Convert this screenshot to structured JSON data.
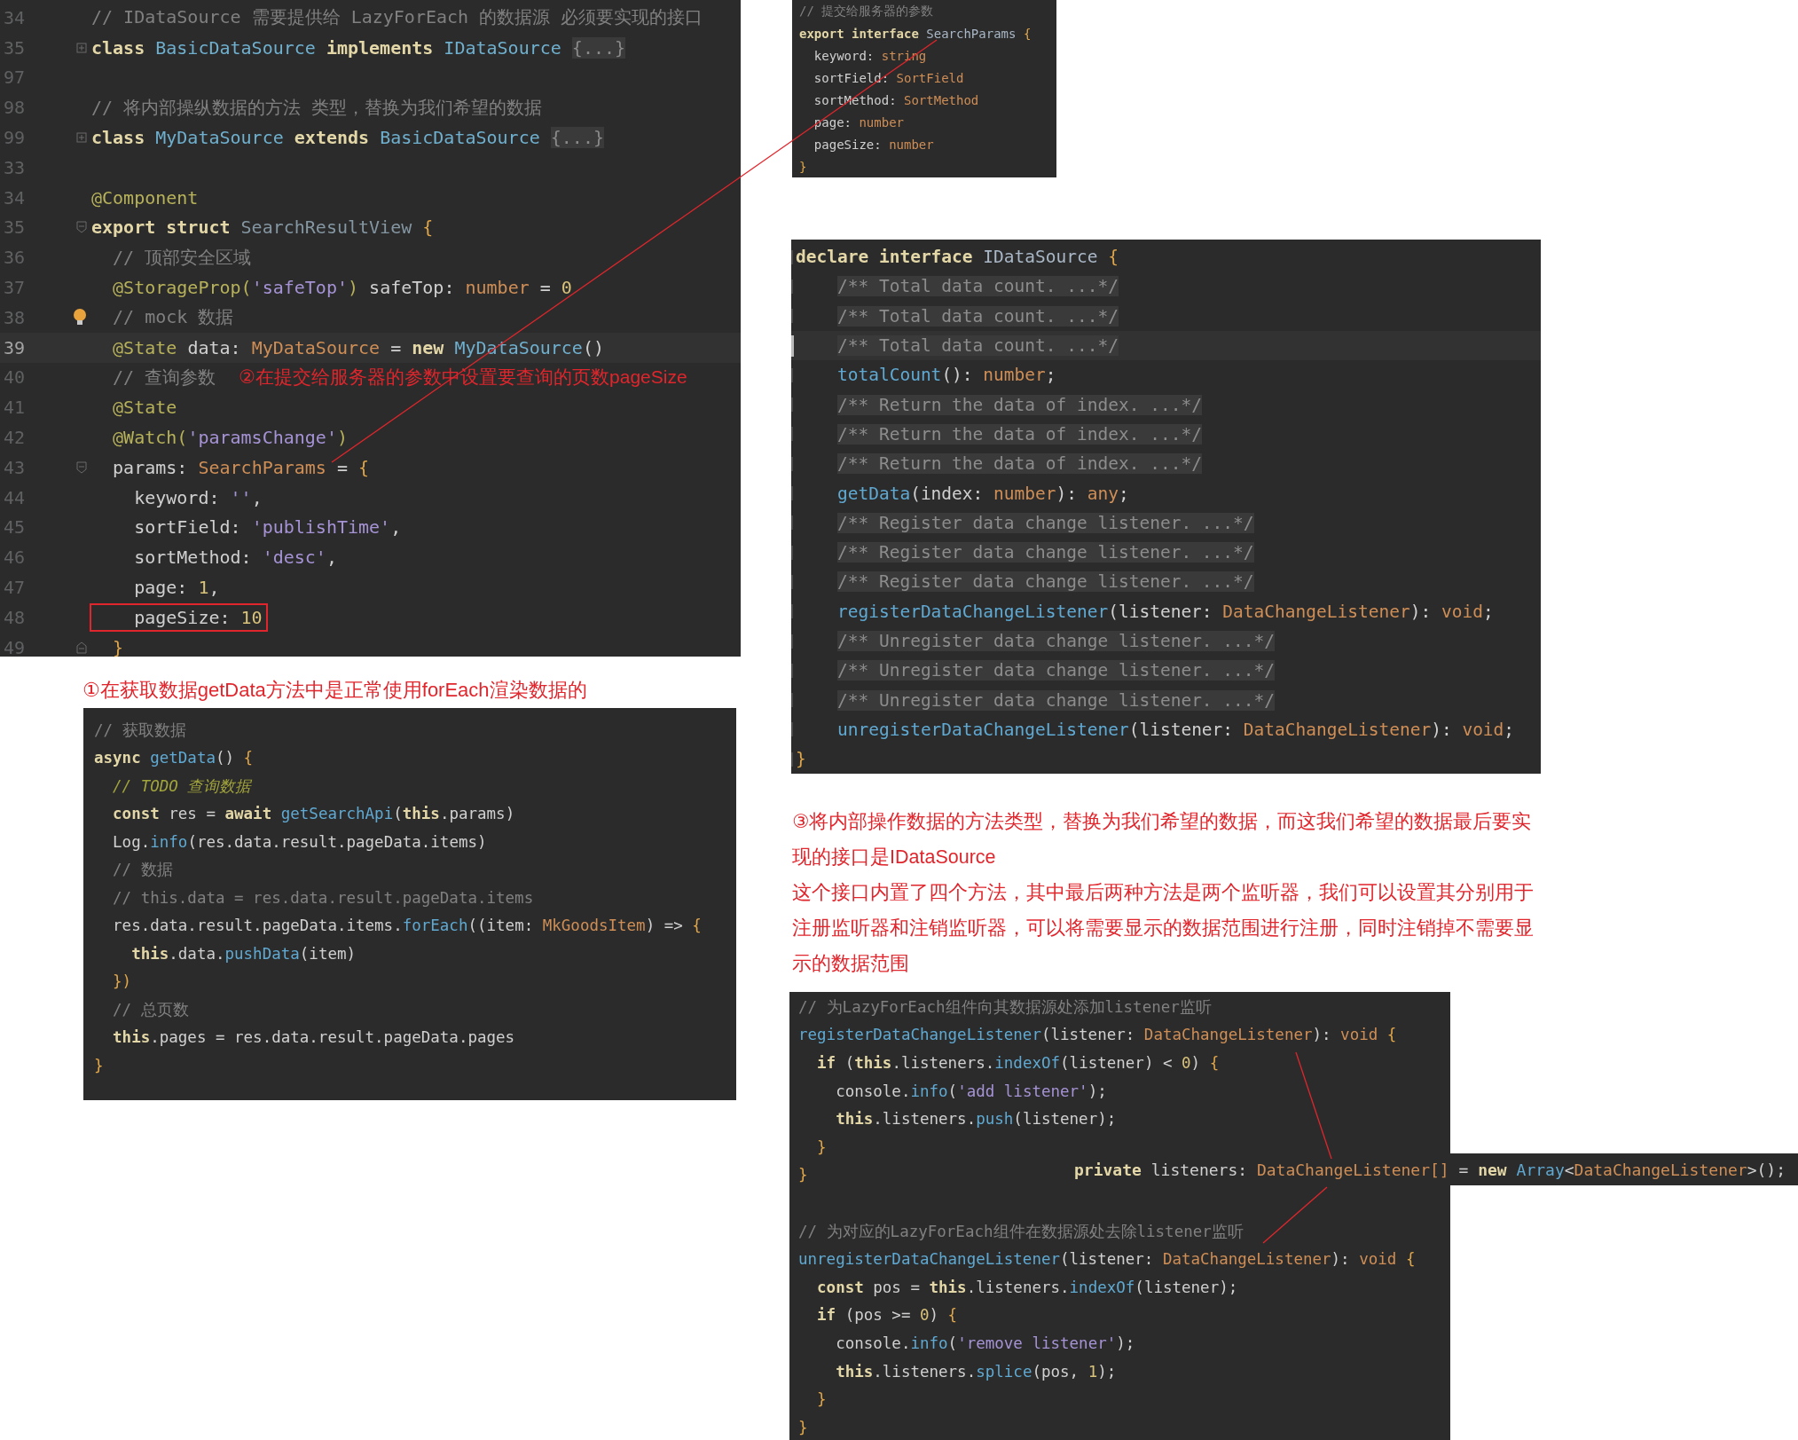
{
  "panels": [
    {
      "kind": "editor",
      "lines": [
        {
          "number": "34",
          "kind": "plain",
          "current": false,
          "boxed": false,
          "tokens": [
            {
              "kind": "cm",
              "text": "// IDataSource 需要提供给 LazyForEach 的数据源 必须要实现的接口"
            }
          ]
        },
        {
          "number": "35",
          "kind": "fold-collapsed",
          "current": false,
          "boxed": false,
          "tokens": [
            {
              "kind": "kw",
              "text": "class "
            },
            {
              "kind": "cls",
              "text": "BasicDataSource "
            },
            {
              "kind": "kw",
              "text": "implements "
            },
            {
              "kind": "cls",
              "text": "IDataSource "
            },
            {
              "kind": "fold",
              "text": "{...}"
            }
          ]
        },
        {
          "number": "97",
          "kind": "plain",
          "current": false
        },
        {
          "number": "98",
          "kind": "plain",
          "current": false,
          "boxed": false,
          "tokens": [
            {
              "kind": "cm",
              "text": "// 将内部操纵数据的方法 类型，替换为我们希望的数据"
            }
          ]
        },
        {
          "number": "99",
          "kind": "fold-collapsed",
          "current": false,
          "boxed": false,
          "tokens": [
            {
              "kind": "kw",
              "text": "class "
            },
            {
              "kind": "cls",
              "text": "MyDataSource "
            },
            {
              "kind": "kw",
              "text": "extends "
            },
            {
              "kind": "cls",
              "text": "BasicDataSource "
            },
            {
              "kind": "fold",
              "text": "{...}"
            }
          ]
        },
        {
          "number": "33",
          "kind": "plain",
          "current": false
        },
        {
          "number": "34",
          "kind": "plain",
          "current": false,
          "boxed": false,
          "tokens": [
            {
              "kind": "deco",
              "text": "@Component"
            }
          ]
        },
        {
          "number": "35",
          "kind": "fold-open",
          "current": false,
          "boxed": false,
          "tokens": [
            {
              "kind": "kw",
              "text": "export struct "
            },
            {
              "kind": "dim",
              "text": "SearchResultView "
            },
            {
              "kind": "punc",
              "text": "{"
            }
          ]
        },
        {
          "number": "36",
          "kind": "plain",
          "current": false,
          "boxed": false,
          "tokens": [
            {
              "kind": "cm",
              "text": "  // 顶部安全区域"
            }
          ]
        },
        {
          "number": "37",
          "kind": "plain",
          "current": false,
          "boxed": false,
          "tokens": [
            {
              "kind": "deco",
              "text": "  @StorageProp("
            },
            {
              "kind": "str",
              "text": "'safeTop'"
            },
            {
              "kind": "deco",
              "text": ") "
            },
            {
              "kind": "plain",
              "text": "safeTop: "
            },
            {
              "kind": "type",
              "text": "number"
            },
            {
              "kind": "plain",
              "text": " = "
            },
            {
              "kind": "num",
              "text": "0"
            }
          ]
        },
        {
          "number": "38",
          "kind": "bulb",
          "current": false,
          "boxed": false,
          "tokens": [
            {
              "kind": "cm",
              "text": "  // mock 数据"
            }
          ]
        },
        {
          "number": "39",
          "kind": "plain",
          "current": true,
          "boxed": false,
          "tokens": [
            {
              "kind": "deco",
              "text": "  @State "
            },
            {
              "kind": "plain",
              "text": "data: "
            },
            {
              "kind": "type",
              "text": "MyDataSource"
            },
            {
              "kind": "plain",
              "text": " = "
            },
            {
              "kind": "kw",
              "text": "new "
            },
            {
              "kind": "cls",
              "text": "MyDataSource"
            },
            {
              "kind": "plain",
              "text": "()"
            }
          ]
        },
        {
          "number": "40",
          "kind": "plain",
          "current": false,
          "boxed": false,
          "annotation": "②在提交给服务器的参数中设置要查询的页数pageSize",
          "tokens": [
            {
              "kind": "cm",
              "text": "  // 查询参数"
            }
          ]
        },
        {
          "number": "41",
          "kind": "plain",
          "current": false,
          "boxed": false,
          "tokens": [
            {
              "kind": "deco",
              "text": "  @State"
            }
          ]
        },
        {
          "number": "42",
          "kind": "plain",
          "current": false,
          "boxed": false,
          "tokens": [
            {
              "kind": "deco",
              "text": "  @Watch("
            },
            {
              "kind": "str",
              "text": "'paramsChange'"
            },
            {
              "kind": "deco",
              "text": ")"
            }
          ]
        },
        {
          "number": "43",
          "kind": "fold-open",
          "current": false,
          "boxed": false,
          "tokens": [
            {
              "kind": "plain",
              "text": "  params: "
            },
            {
              "kind": "type",
              "text": "SearchParams"
            },
            {
              "kind": "plain",
              "text": " = "
            },
            {
              "kind": "punc",
              "text": "{"
            }
          ]
        },
        {
          "number": "44",
          "kind": "plain",
          "current": false,
          "boxed": false,
          "tokens": [
            {
              "kind": "plain",
              "text": "    keyword: "
            },
            {
              "kind": "str",
              "text": "''"
            },
            {
              "kind": "plain",
              "text": ","
            }
          ]
        },
        {
          "number": "45",
          "kind": "plain",
          "current": false,
          "boxed": false,
          "tokens": [
            {
              "kind": "plain",
              "text": "    sortField: "
            },
            {
              "kind": "str",
              "text": "'publishTime'"
            },
            {
              "kind": "plain",
              "text": ","
            }
          ]
        },
        {
          "number": "46",
          "kind": "plain",
          "current": false,
          "boxed": false,
          "tokens": [
            {
              "kind": "plain",
              "text": "    sortMethod: "
            },
            {
              "kind": "str",
              "text": "'desc'"
            },
            {
              "kind": "plain",
              "text": ","
            }
          ]
        },
        {
          "number": "47",
          "kind": "plain",
          "current": false,
          "boxed": false,
          "tokens": [
            {
              "kind": "plain",
              "text": "    page: "
            },
            {
              "kind": "num",
              "text": "1"
            },
            {
              "kind": "plain",
              "text": ","
            }
          ]
        },
        {
          "number": "48",
          "kind": "plain",
          "current": false,
          "boxed": true,
          "tokens": [
            {
              "kind": "plain",
              "text": "    pageSize: "
            },
            {
              "kind": "num",
              "text": "10"
            }
          ]
        },
        {
          "number": "49",
          "kind": "fold-close",
          "current": false,
          "boxed": false,
          "tokens": [
            {
              "kind": "punc",
              "text": "  }"
            }
          ]
        }
      ]
    },
    {
      "kind": "code",
      "lines": [
        {
          "tokens": [
            {
              "kind": "cm",
              "text": "// 提交给服务器的参数"
            }
          ]
        },
        {
          "tokens": [
            {
              "kind": "kw",
              "text": "export interface "
            },
            {
              "kind": "ident",
              "text": "SearchParams "
            },
            {
              "kind": "punc",
              "text": "{"
            }
          ]
        },
        {
          "tokens": [
            {
              "kind": "plain",
              "text": "  keyword: "
            },
            {
              "kind": "type",
              "text": "string"
            }
          ]
        },
        {
          "tokens": [
            {
              "kind": "plain",
              "text": "  sortField: "
            },
            {
              "kind": "type",
              "text": "SortField"
            }
          ]
        },
        {
          "tokens": [
            {
              "kind": "plain",
              "text": "  sortMethod: "
            },
            {
              "kind": "type",
              "text": "SortMethod"
            }
          ]
        },
        {
          "tokens": [
            {
              "kind": "plain",
              "text": "  page: "
            },
            {
              "kind": "type",
              "text": "number"
            }
          ]
        },
        {
          "tokens": [
            {
              "kind": "plain",
              "text": "  pageSize: "
            },
            {
              "kind": "type",
              "text": "number"
            }
          ]
        },
        {
          "tokens": [
            {
              "kind": "punc",
              "text": "}"
            }
          ]
        }
      ]
    },
    {
      "kind": "editor",
      "lines": [
        {
          "current": false,
          "tokens": [
            {
              "kind": "kw",
              "text": "declare interface "
            },
            {
              "kind": "ident",
              "text": "IDataSource "
            },
            {
              "kind": "punc",
              "text": "{"
            }
          ]
        },
        {
          "current": false,
          "tokens": [
            {
              "kind": "doc",
              "text": "    /** Total data count. ...*/"
            }
          ]
        },
        {
          "current": false,
          "tokens": [
            {
              "kind": "doc",
              "text": "    /** Total data count. ...*/"
            }
          ]
        },
        {
          "current": true,
          "tokens": [
            {
              "kind": "doc",
              "text": "    /** Total data count. ...*/"
            }
          ]
        },
        {
          "current": false,
          "tokens": [
            {
              "kind": "fn",
              "text": "    totalCount"
            },
            {
              "kind": "plain",
              "text": "(): "
            },
            {
              "kind": "type",
              "text": "number"
            },
            {
              "kind": "plain",
              "text": ";"
            }
          ]
        },
        {
          "current": false,
          "tokens": [
            {
              "kind": "doc",
              "text": "    /** Return the data of index. ...*/"
            }
          ]
        },
        {
          "current": false,
          "tokens": [
            {
              "kind": "doc",
              "text": "    /** Return the data of index. ...*/"
            }
          ]
        },
        {
          "current": false,
          "tokens": [
            {
              "kind": "doc",
              "text": "    /** Return the data of index. ...*/"
            }
          ]
        },
        {
          "current": false,
          "tokens": [
            {
              "kind": "fn",
              "text": "    getData"
            },
            {
              "kind": "plain",
              "text": "(index: "
            },
            {
              "kind": "type",
              "text": "number"
            },
            {
              "kind": "plain",
              "text": "): "
            },
            {
              "kind": "type",
              "text": "any"
            },
            {
              "kind": "plain",
              "text": ";"
            }
          ]
        },
        {
          "current": false,
          "tokens": [
            {
              "kind": "doc",
              "text": "    /** Register data change listener. ...*/"
            }
          ]
        },
        {
          "current": false,
          "tokens": [
            {
              "kind": "doc",
              "text": "    /** Register data change listener. ...*/"
            }
          ]
        },
        {
          "current": false,
          "tokens": [
            {
              "kind": "doc",
              "text": "    /** Register data change listener. ...*/"
            }
          ]
        },
        {
          "current": false,
          "tokens": [
            {
              "kind": "fn",
              "text": "    registerDataChangeListener"
            },
            {
              "kind": "plain",
              "text": "(listener: "
            },
            {
              "kind": "type",
              "text": "DataChangeListener"
            },
            {
              "kind": "plain",
              "text": "): "
            },
            {
              "kind": "type",
              "text": "void"
            },
            {
              "kind": "plain",
              "text": ";"
            }
          ]
        },
        {
          "current": false,
          "tokens": [
            {
              "kind": "doc",
              "text": "    /** Unregister data change listener. ...*/"
            }
          ]
        },
        {
          "current": false,
          "tokens": [
            {
              "kind": "doc",
              "text": "    /** Unregister data change listener. ...*/"
            }
          ]
        },
        {
          "current": false,
          "tokens": [
            {
              "kind": "doc",
              "text": "    /** Unregister data change listener. ...*/"
            }
          ]
        },
        {
          "current": false,
          "tokens": [
            {
              "kind": "fn",
              "text": "    unregisterDataChangeListener"
            },
            {
              "kind": "plain",
              "text": "(listener: "
            },
            {
              "kind": "type",
              "text": "DataChangeListener"
            },
            {
              "kind": "plain",
              "text": "): "
            },
            {
              "kind": "type",
              "text": "void"
            },
            {
              "kind": "plain",
              "text": ";"
            }
          ]
        },
        {
          "current": false,
          "tokens": [
            {
              "kind": "punc",
              "text": "}"
            }
          ]
        }
      ]
    },
    {
      "kind": "note",
      "paragraphs": [
        "①在获取数据getData方法中是正常使用forEach渲染数据的"
      ]
    },
    {
      "kind": "code",
      "lines": [
        {
          "tokens": [
            {
              "kind": "cm",
              "text": "// 获取数据"
            }
          ]
        },
        {
          "tokens": [
            {
              "kind": "kw",
              "text": "async "
            },
            {
              "kind": "fn",
              "text": "getData"
            },
            {
              "kind": "plain",
              "text": "() "
            },
            {
              "kind": "punc",
              "text": "{"
            }
          ]
        },
        {
          "tokens": [
            {
              "kind": "todo",
              "text": "  // TODO 查询数据"
            }
          ]
        },
        {
          "tokens": [
            {
              "kind": "kw",
              "text": "  const "
            },
            {
              "kind": "plain",
              "text": "res = "
            },
            {
              "kind": "kw",
              "text": "await "
            },
            {
              "kind": "fn",
              "text": "getSearchApi"
            },
            {
              "kind": "plain",
              "text": "("
            },
            {
              "kind": "kw",
              "text": "this"
            },
            {
              "kind": "plain",
              "text": ".params)"
            }
          ]
        },
        {
          "tokens": [
            {
              "kind": "plain",
              "text": "  Log."
            },
            {
              "kind": "fn",
              "text": "info"
            },
            {
              "kind": "plain",
              "text": "(res.data.result.pageData.items)"
            }
          ]
        },
        {
          "tokens": [
            {
              "kind": "cm",
              "text": "  // 数据"
            }
          ]
        },
        {
          "tokens": [
            {
              "kind": "cm",
              "text": "  // this.data = res.data.result.pageData.items"
            }
          ]
        },
        {
          "tokens": [
            {
              "kind": "plain",
              "text": "  res.data.result.pageData.items."
            },
            {
              "kind": "fn",
              "text": "forEach"
            },
            {
              "kind": "plain",
              "text": "((item: "
            },
            {
              "kind": "type",
              "text": "MkGoodsItem"
            },
            {
              "kind": "plain",
              "text": ") => "
            },
            {
              "kind": "punc",
              "text": "{"
            }
          ]
        },
        {
          "tokens": [
            {
              "kind": "kw",
              "text": "    this"
            },
            {
              "kind": "plain",
              "text": ".data."
            },
            {
              "kind": "fn",
              "text": "pushData"
            },
            {
              "kind": "plain",
              "text": "(item)"
            }
          ]
        },
        {
          "tokens": [
            {
              "kind": "punc",
              "text": "  })"
            }
          ]
        },
        {
          "tokens": [
            {
              "kind": "cm",
              "text": "  // 总页数"
            }
          ]
        },
        {
          "tokens": [
            {
              "kind": "kw",
              "text": "  this"
            },
            {
              "kind": "plain",
              "text": ".pages = res.data.result.pageData.pages"
            }
          ]
        },
        {
          "tokens": [
            {
              "kind": "punc",
              "text": "}"
            }
          ]
        }
      ]
    },
    {
      "kind": "note",
      "paragraphs": [
        "③将内部操作数据的方法类型，替换为我们希望的数据，而这我们希望的数据最后要实现的接口是IDataSource",
        "这个接口内置了四个方法，其中最后两种方法是两个监听器，我们可以设置其分别用于注册监听器和注销监听器，可以将需要显示的数据范围进行注册，同时注销掉不需要显示的数据范围"
      ]
    },
    {
      "kind": "code",
      "lines": [
        {
          "tokens": [
            {
              "kind": "cm",
              "text": "// 为LazyForEach组件向其数据源处添加listener监听"
            }
          ]
        },
        {
          "tokens": [
            {
              "kind": "fn",
              "text": "registerDataChangeListener"
            },
            {
              "kind": "plain",
              "text": "(listener: "
            },
            {
              "kind": "type",
              "text": "DataChangeListener"
            },
            {
              "kind": "plain",
              "text": "): "
            },
            {
              "kind": "type",
              "text": "void "
            },
            {
              "kind": "punc",
              "text": "{"
            }
          ]
        },
        {
          "tokens": [
            {
              "kind": "kw",
              "text": "  if "
            },
            {
              "kind": "plain",
              "text": "("
            },
            {
              "kind": "kw",
              "text": "this"
            },
            {
              "kind": "plain",
              "text": ".listeners."
            },
            {
              "kind": "fn",
              "text": "indexOf"
            },
            {
              "kind": "plain",
              "text": "(listener) < "
            },
            {
              "kind": "num",
              "text": "0"
            },
            {
              "kind": "plain",
              "text": ") "
            },
            {
              "kind": "punc",
              "text": "{"
            }
          ]
        },
        {
          "tokens": [
            {
              "kind": "plain",
              "text": "    console."
            },
            {
              "kind": "fn",
              "text": "info"
            },
            {
              "kind": "plain",
              "text": "("
            },
            {
              "kind": "str",
              "text": "'add listener'"
            },
            {
              "kind": "plain",
              "text": ");"
            }
          ]
        },
        {
          "tokens": [
            {
              "kind": "kw",
              "text": "    this"
            },
            {
              "kind": "plain",
              "text": ".listeners."
            },
            {
              "kind": "fn",
              "text": "push"
            },
            {
              "kind": "plain",
              "text": "(listener);"
            }
          ]
        },
        {
          "tokens": [
            {
              "kind": "punc",
              "text": "  }"
            }
          ]
        },
        {
          "tokens": [
            {
              "kind": "punc",
              "text": "}"
            }
          ]
        },
        {
          "kind": "blank"
        },
        {
          "tokens": [
            {
              "kind": "cm",
              "text": "// 为对应的LazyForEach组件在数据源处去除listener监听"
            }
          ]
        },
        {
          "tokens": [
            {
              "kind": "fn",
              "text": "unregisterDataChangeListener"
            },
            {
              "kind": "plain",
              "text": "(listener: "
            },
            {
              "kind": "type",
              "text": "DataChangeListener"
            },
            {
              "kind": "plain",
              "text": "): "
            },
            {
              "kind": "type",
              "text": "void "
            },
            {
              "kind": "punc",
              "text": "{"
            }
          ]
        },
        {
          "tokens": [
            {
              "kind": "kw",
              "text": "  const "
            },
            {
              "kind": "plain",
              "text": "pos = "
            },
            {
              "kind": "kw",
              "text": "this"
            },
            {
              "kind": "plain",
              "text": ".listeners."
            },
            {
              "kind": "fn",
              "text": "indexOf"
            },
            {
              "kind": "plain",
              "text": "(listener);"
            }
          ]
        },
        {
          "tokens": [
            {
              "kind": "kw",
              "text": "  if "
            },
            {
              "kind": "plain",
              "text": "(pos >= "
            },
            {
              "kind": "num",
              "text": "0"
            },
            {
              "kind": "plain",
              "text": ") "
            },
            {
              "kind": "punc",
              "text": "{"
            }
          ]
        },
        {
          "tokens": [
            {
              "kind": "plain",
              "text": "    console."
            },
            {
              "kind": "fn",
              "text": "info"
            },
            {
              "kind": "plain",
              "text": "("
            },
            {
              "kind": "str",
              "text": "'remove listener'"
            },
            {
              "kind": "plain",
              "text": ");"
            }
          ]
        },
        {
          "tokens": [
            {
              "kind": "kw",
              "text": "    this"
            },
            {
              "kind": "plain",
              "text": ".listeners."
            },
            {
              "kind": "fn",
              "text": "splice"
            },
            {
              "kind": "plain",
              "text": "(pos, "
            },
            {
              "kind": "num",
              "text": "1"
            },
            {
              "kind": "plain",
              "text": ");"
            }
          ]
        },
        {
          "tokens": [
            {
              "kind": "punc",
              "text": "  }"
            }
          ]
        },
        {
          "tokens": [
            {
              "kind": "punc",
              "text": "}"
            }
          ]
        }
      ]
    },
    {
      "kind": "code",
      "lines": [
        {
          "tokens": [
            {
              "kind": "kw",
              "text": "private "
            },
            {
              "kind": "plain",
              "text": "listeners: "
            },
            {
              "kind": "type",
              "text": "DataChangeListener[]"
            },
            {
              "kind": "plain",
              "text": " = "
            },
            {
              "kind": "kw",
              "text": "new "
            },
            {
              "kind": "fn",
              "text": "Array"
            },
            {
              "kind": "plain",
              "text": "<"
            },
            {
              "kind": "type",
              "text": "DataChangeListener"
            },
            {
              "kind": "plain",
              "text": ">();"
            }
          ]
        }
      ]
    }
  ]
}
